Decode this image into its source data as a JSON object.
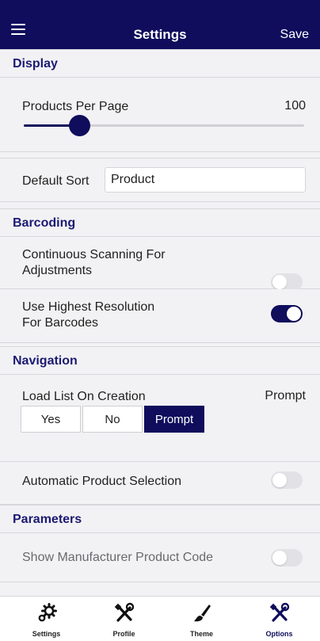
{
  "header": {
    "title": "Settings",
    "save_label": "Save"
  },
  "sections": {
    "display": "Display",
    "barcoding": "Barcoding",
    "navigation": "Navigation",
    "parameters": "Parameters"
  },
  "display": {
    "products_per_page_label": "Products Per Page",
    "products_per_page_value": "100",
    "slider_fraction": 0.2,
    "default_sort_label": "Default Sort",
    "default_sort_value": "Product"
  },
  "barcoding": {
    "continuous_scanning_label_line1": "Continuous Scanning For",
    "continuous_scanning_label_line2": "Adjustments",
    "continuous_scanning_on": false,
    "highest_resolution_label_line1": "Use Highest Resolution",
    "highest_resolution_label_line2": "For Barcodes",
    "highest_resolution_on": true
  },
  "navigation": {
    "load_list_label": "Load List On Creation",
    "load_list_value": "Prompt",
    "options": [
      "Yes",
      "No",
      "Prompt"
    ],
    "selected_option": "Prompt",
    "auto_selection_label": "Automatic Product Selection",
    "auto_selection_on": false
  },
  "parameters": {
    "manufacturer_code_label": "Show Manufacturer Product Code",
    "manufacturer_code_on": false
  },
  "tabs": [
    {
      "label": "Settings",
      "icon": "gears-icon"
    },
    {
      "label": "Profile",
      "icon": "tools-icon"
    },
    {
      "label": "Theme",
      "icon": "brush-icon"
    },
    {
      "label": "Options",
      "icon": "tools-icon"
    }
  ],
  "active_tab": "Options",
  "colors": {
    "accent": "#0f0d5c",
    "section_text": "#1c1a72"
  }
}
